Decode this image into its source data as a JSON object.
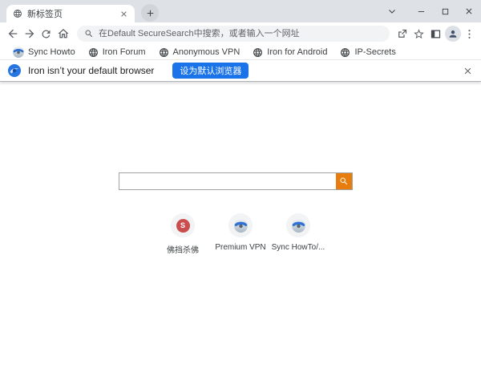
{
  "tab": {
    "title": "新标签页"
  },
  "toolbar": {
    "address_placeholder": "在Default SecureSearch中搜索，或者输入一个网址"
  },
  "bookmarks": {
    "items": [
      {
        "label": "Sync Howto",
        "icon": "iron-sphere-icon"
      },
      {
        "label": "Iron Forum",
        "icon": "globe-icon"
      },
      {
        "label": "Anonymous VPN",
        "icon": "globe-icon"
      },
      {
        "label": "Iron for Android",
        "icon": "globe-icon"
      },
      {
        "label": "IP-Secrets",
        "icon": "globe-icon"
      }
    ]
  },
  "infobar": {
    "message": "Iron isn’t your default browser",
    "set_default_button": "设为默认浏览器"
  },
  "main": {
    "search": {
      "value": ""
    },
    "shortcuts": [
      {
        "label": "佛挡杀佛",
        "monogram": "S",
        "monogram_color": "#cb4e4e",
        "icon": "letter-avatar"
      },
      {
        "label": "Premium VPN",
        "icon": "iron-sphere-icon"
      },
      {
        "label": "Sync HowTo/...",
        "icon": "iron-sphere-icon"
      }
    ]
  },
  "colors": {
    "titlebar": "#dee1e6",
    "accent_blue": "#1a73e8",
    "search_button_orange": "#e87d0e",
    "icon_gray": "#5f6368"
  }
}
